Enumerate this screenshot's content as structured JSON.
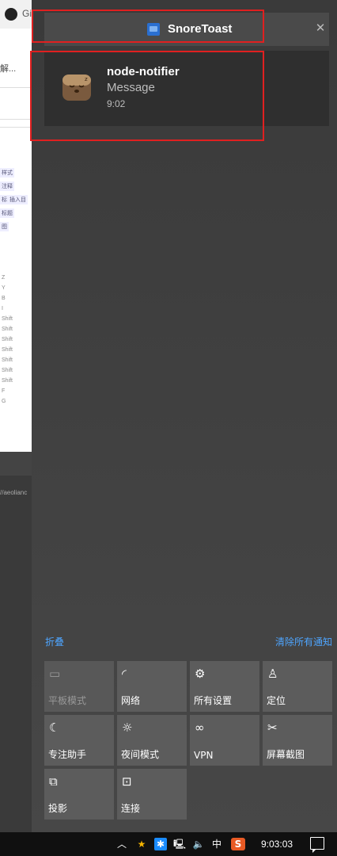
{
  "background": {
    "tab_text": "Gi",
    "text_1": "解...",
    "tags": [
      "样式",
      "注释",
      "插入目",
      "标",
      "标题",
      "图"
    ],
    "keys": [
      "Z",
      "Y",
      "B",
      "I",
      "Shift",
      "Shift",
      "Shift",
      "Shift",
      "Shift",
      "Shift",
      "Shift",
      "F",
      "G"
    ],
    "url": "//aeolianc"
  },
  "header": {
    "app_name": "SnoreToast"
  },
  "notification": {
    "title": "node-notifier",
    "message": "Message",
    "time": "9:02"
  },
  "actions": {
    "collapse": "折叠",
    "clear_all": "清除所有通知"
  },
  "tiles": [
    {
      "label": "平板模式",
      "icon": "tablet-mode-icon",
      "enabled": false
    },
    {
      "label": "网络",
      "icon": "network-icon",
      "enabled": true
    },
    {
      "label": "所有设置",
      "icon": "gear-icon",
      "enabled": true
    },
    {
      "label": "定位",
      "icon": "location-icon",
      "enabled": true
    },
    {
      "label": "专注助手",
      "icon": "moon-icon",
      "enabled": true
    },
    {
      "label": "夜间模式",
      "icon": "night-light-icon",
      "enabled": true
    },
    {
      "label": "VPN",
      "icon": "vpn-icon",
      "enabled": true
    },
    {
      "label": "屏幕截图",
      "icon": "screenshot-icon",
      "enabled": true
    },
    {
      "label": "投影",
      "icon": "project-icon",
      "enabled": true
    },
    {
      "label": "连接",
      "icon": "connect-icon",
      "enabled": true
    }
  ],
  "taskbar": {
    "ime": "中",
    "time": "9:03:03"
  }
}
